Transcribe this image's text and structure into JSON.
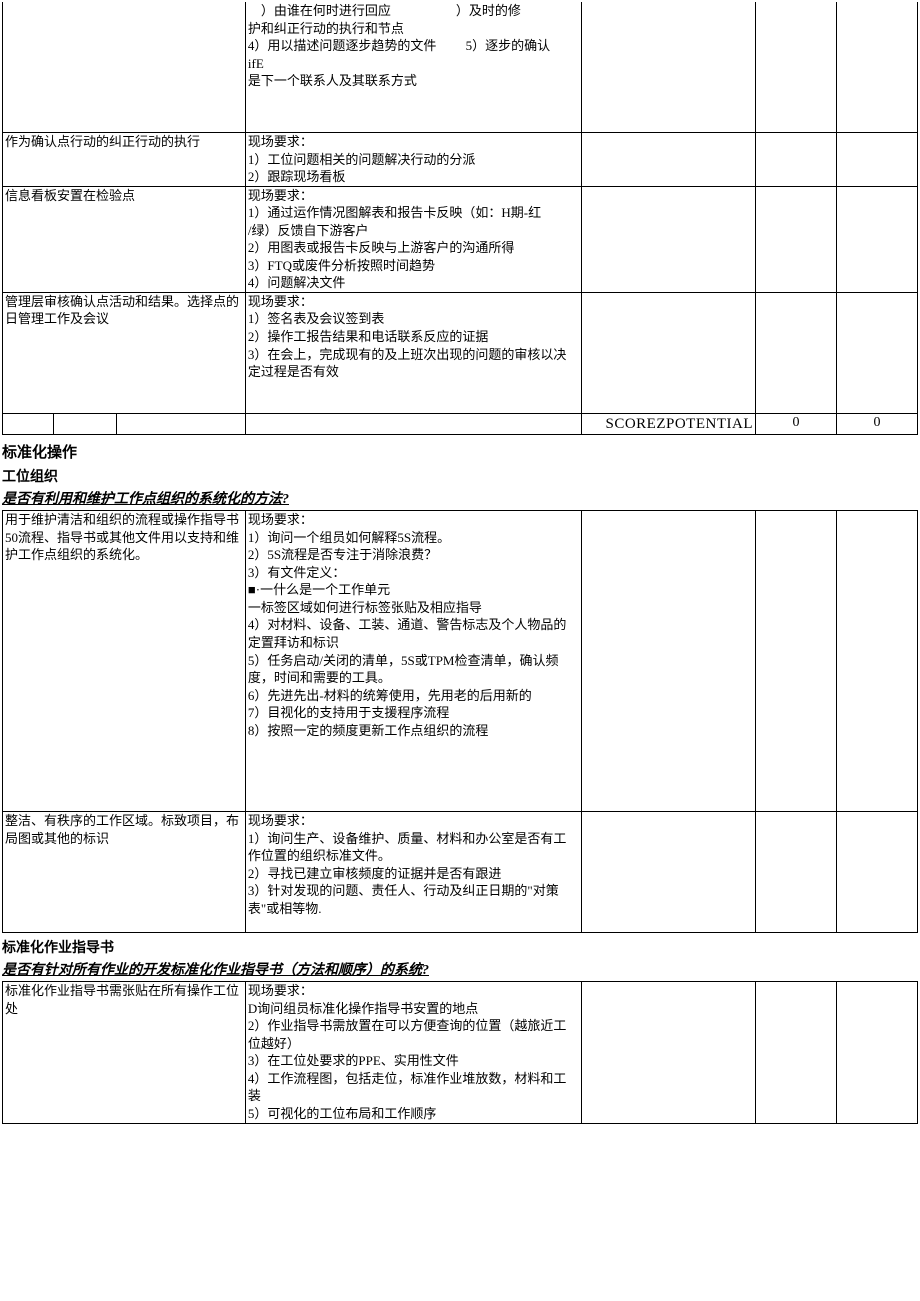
{
  "table1": {
    "row1": {
      "col1": "",
      "col2": "　）由谁在何时进行回应　　　　　）及时的修\n护和纠正行动的执行和节点\n4）用以描述问题逐步趋势的文件　　 5）逐步的确认\nifE\n是下一个联系人及其联系方式"
    },
    "row2": {
      "col1": "作为确认点行动的纠正行动的执行",
      "col2": "现场要求：\n1）工位问题相关的问题解决行动的分派\n2）跟踪现场看板"
    },
    "row3": {
      "col1": "信息看板安置在检验点",
      "col2": "现场要求：\n1）通过运作情况图解表和报告卡反映（如：H期-红\n/绿）反馈自下游客户\n2）用图表或报告卡反映与上游客户的沟通所得\n3）FTQ或废件分析按照时间趋势\n4）问题解决文件"
    },
    "row4": {
      "col1": "管理层审核确认点活动和结果。选择点的日管理工作及会议",
      "col2": "现场要求：\n1）签名表及会议签到表\n2）操作工报告结果和电话联系反应的证据\n3）在会上，完成现有的及上班次出现的问题的审核以决定过程是否有效"
    },
    "footer": {
      "label": "SCOREZPOTENTIAL",
      "val1": "0",
      "val2": "0"
    }
  },
  "sec1": {
    "heading": "标准化操作",
    "sub": "工位组织",
    "question": "是否有利用和维护工作点组织的系统化的方法?"
  },
  "table2": {
    "row1": {
      "col1": "用于维护清洁和组织的流程或操作指导书50流程、指导书或其他文件用以支持和维护工作点组织的系统化。",
      "col2": "现场要求：\n1）询问一个组员如何解释5S流程。\n2）5S流程是否专注于消除浪费？\n3）有文件定义：\n■·一什么是一个工作单元\n一标签区域如何进行标签张贴及相应指导\n4）对材料、设备、工装、通道、警告标志及个人物品的定置拜访和标识\n5）任务启动/关闭的清单，5S或TPM检查清单，确认频度，时间和需要的工具。\n6）先进先出-材料的统筹使用，先用老的后用新的\n7）目视化的支持用于支援程序流程\n8）按照一定的频度更新工作点组织的流程"
    },
    "row2": {
      "col1": "整洁、有秩序的工作区域。标致项目，布局图或其他的标识",
      "col2": "现场要求：\n1）询问生产、设备维护、质量、材料和办公室是否有工作位置的组织标准文件。\n2）寻找已建立审核频度的证据并是否有跟进\n3）针对发现的问题、责任人、行动及纠正日期的\"对策表\"或相等物."
    }
  },
  "sec2": {
    "sub": "标准化作业指导书",
    "question": "是否有针对所有作业的开发标准化作业指导书（方法和顺序）的系统?"
  },
  "table3": {
    "row1": {
      "col1": "标准化作业指导书需张贴在所有操作工位处",
      "col2": "现场要求：\nD询问组员标准化操作指导书安置的地点\n2）作业指导书需放置在可以方便查询的位置（越旅近工位越好）\n3）在工位处要求的PPE、实用性文件\n4）工作流程图，包括走位，标准作业堆放数，材料和工装\n5）可视化的工位布局和工作顺序"
    }
  }
}
